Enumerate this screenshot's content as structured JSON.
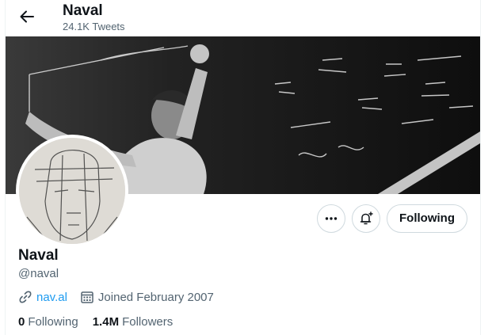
{
  "header": {
    "title": "Naval",
    "tweet_count": "24.1K Tweets"
  },
  "profile": {
    "name": "Naval",
    "handle": "@naval",
    "website": "nav.al",
    "joined": "Joined February 2007",
    "following_count": "0",
    "following_label": "Following",
    "followers_count": "1.4M",
    "followers_label": "Followers"
  },
  "actions": {
    "follow_label": "Following",
    "more_icon": "more-icon",
    "notify_icon": "bell-plus-icon"
  },
  "icons": {
    "back": "arrow-left-icon",
    "link": "link-icon",
    "calendar": "calendar-icon"
  },
  "colors": {
    "accent": "#1d9bf0",
    "text": "#0f1419",
    "secondary": "#536471",
    "border": "#cfd9de"
  }
}
